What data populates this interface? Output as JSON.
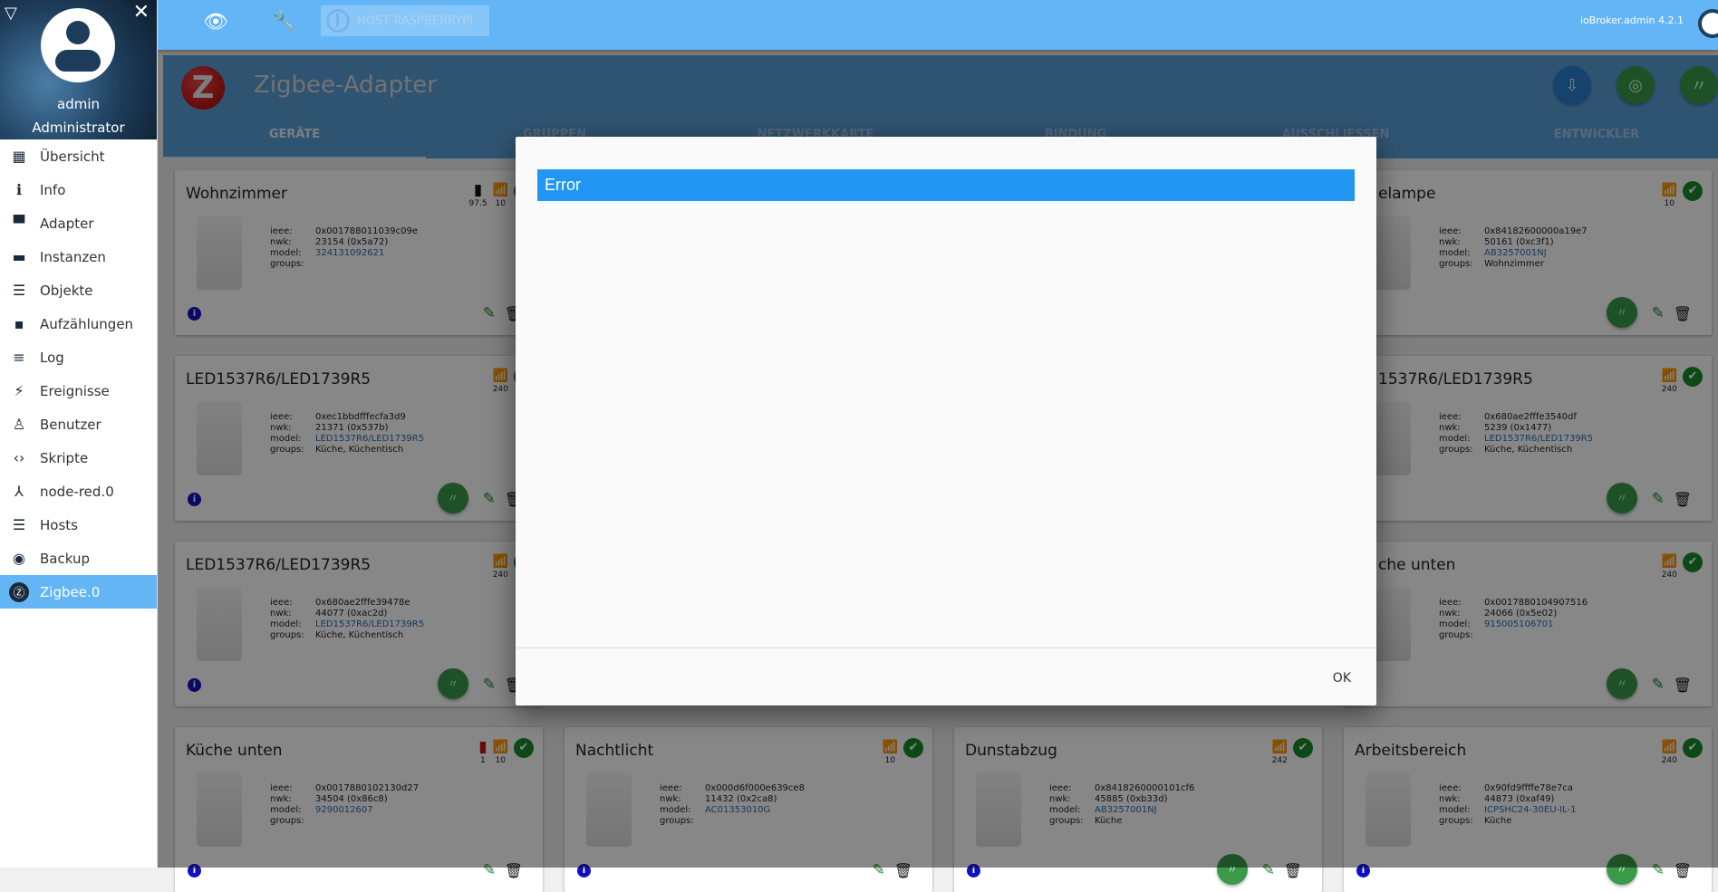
{
  "sidebar": {
    "user": "admin",
    "role": "Administrator",
    "items": [
      {
        "label": "Übersicht",
        "icon": "grid-icon",
        "glyph": "▦"
      },
      {
        "label": "Info",
        "icon": "info-icon",
        "glyph": "ℹ"
      },
      {
        "label": "Adapter",
        "icon": "store-icon",
        "glyph": "▀"
      },
      {
        "label": "Instanzen",
        "icon": "instances-icon",
        "glyph": "▬"
      },
      {
        "label": "Objekte",
        "icon": "list-icon",
        "glyph": "☰"
      },
      {
        "label": "Aufzählungen",
        "icon": "enum-icon",
        "glyph": "▪"
      },
      {
        "label": "Log",
        "icon": "log-icon",
        "glyph": "≡"
      },
      {
        "label": "Ereignisse",
        "icon": "lightning-icon",
        "glyph": "⚡"
      },
      {
        "label": "Benutzer",
        "icon": "user-icon",
        "glyph": "♙"
      },
      {
        "label": "Skripte",
        "icon": "code-icon",
        "glyph": "‹›"
      },
      {
        "label": "node-red.0",
        "icon": "node-red-icon",
        "glyph": "⅄"
      },
      {
        "label": "Hosts",
        "icon": "hosts-icon",
        "glyph": "☰"
      },
      {
        "label": "Backup",
        "icon": "backup-icon",
        "glyph": "◉"
      },
      {
        "label": "Zigbee.0",
        "icon": "zigbee-icon",
        "glyph": "Ⓩ",
        "active": true
      }
    ]
  },
  "topbar": {
    "host": "HOST RASPBERRYPI",
    "version": "ioBroker.admin 4.2.1"
  },
  "header": {
    "title": "Zigbee-Adapter",
    "tabs": [
      "GERÄTE",
      "GRUPPEN",
      "NETZWERKKARTE",
      "BINDUNG",
      "AUSSCHLIESSEN",
      "ENTWICKLER"
    ],
    "active_tab": 0
  },
  "labels": {
    "ieee": "ieee:",
    "nwk": "nwk:",
    "model": "model:",
    "groups": "groups:"
  },
  "colors": {
    "accent": "#64b5f6",
    "error_bar": "#2196f3",
    "ok": "#1a8a2a",
    "weak": "#c0141c"
  },
  "devices": [
    {
      "title": "Wohnzimmer",
      "battery": "97.5",
      "battery_low": false,
      "lq": "10",
      "lq_weak": true,
      "ok": true,
      "ieee": "0x001788011039c09e",
      "nwk": "23154 (0x5a72)",
      "model": "324131092621",
      "groups": "",
      "config": false
    },
    {
      "title": "elampe",
      "lq": "10",
      "lq_weak": true,
      "ok": true,
      "ieee": "0x84182600000a19e7",
      "nwk": "50161 (0xc3f1)",
      "model": "AB3257001NJ",
      "groups": "Wohnzimmer",
      "config": true
    },
    {
      "title": "LED1537R6/LED1739R5",
      "lq": "240",
      "ok": true,
      "ieee": "0xec1bbdfffecfa3d9",
      "nwk": "21371 (0x537b)",
      "model": "LED1537R6/LED1739R5",
      "groups": "Küche, Küchentisch",
      "config": true
    },
    {
      "title": "1537R6/LED1739R5",
      "lq": "240",
      "ok": true,
      "ieee": "0x680ae2fffe3540df",
      "nwk": "5239 (0x1477)",
      "model": "LED1537R6/LED1739R5",
      "groups": "Küche, Küchentisch",
      "config": true
    },
    {
      "title": "LED1537R6/LED1739R5",
      "lq": "240",
      "ok": true,
      "ieee": "0x680ae2fffe39478e",
      "nwk": "44077 (0xac2d)",
      "model": "LED1537R6/LED1739R5",
      "groups": "Küche, Küchentisch",
      "config": true
    },
    {
      "title": "che unten",
      "lq": "240",
      "ok": true,
      "ieee": "0x0017880104907516",
      "nwk": "24066 (0x5e02)",
      "model": "915005106701",
      "groups": "",
      "config": true
    },
    {
      "title": "Küche unten",
      "battery": "1",
      "battery_low": true,
      "lq": "10",
      "lq_weak": true,
      "ok": true,
      "ieee": "0x0017880102130d27",
      "nwk": "34504 (0x86c8)",
      "model": "9290012607",
      "groups": "",
      "config": false
    },
    {
      "title": "Nachtlicht",
      "lq": "10",
      "lq_weak": true,
      "ok": true,
      "ieee": "0x000d6f000e639ce8",
      "nwk": "11432 (0x2ca8)",
      "model": "AC01353010G",
      "groups": "",
      "config": false
    },
    {
      "title": "Dunstabzug",
      "lq": "242",
      "ok": true,
      "ieee": "0x8418260000101cf6",
      "nwk": "45885 (0xb33d)",
      "model": "AB3257001NJ",
      "groups": "Küche",
      "config": true
    },
    {
      "title": "Arbeitsbereich",
      "lq": "240",
      "ok": true,
      "ieee": "0x90fd9ffffe78e7ca",
      "nwk": "44873 (0xaf49)",
      "model": "ICPSHC24-30EU-IL-1",
      "groups": "Küche",
      "config": true
    }
  ],
  "dialog": {
    "title": "Error",
    "ok": "OK"
  }
}
